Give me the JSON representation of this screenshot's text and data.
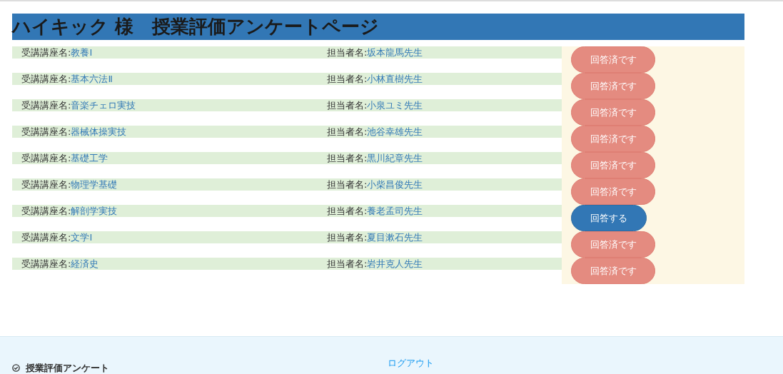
{
  "header": {
    "title": "ハイキック 様　授業評価アンケートページ"
  },
  "rows": [
    {
      "course_label": "受講講座名:",
      "course": "教養Ⅰ",
      "teacher_label": "担当者名:",
      "teacher": "坂本龍馬先生",
      "button": "回答済です",
      "answered": true
    },
    {
      "course_label": "受講講座名:",
      "course": "基本六法Ⅱ",
      "teacher_label": "担当者名:",
      "teacher": "小林直樹先生",
      "button": "回答済です",
      "answered": true
    },
    {
      "course_label": "受講講座名:",
      "course": "音楽チェロ実技",
      "teacher_label": "担当者名:",
      "teacher": "小泉ユミ先生",
      "button": "回答済です",
      "answered": true
    },
    {
      "course_label": "受講講座名:",
      "course": "器械体操実技",
      "teacher_label": "担当者名:",
      "teacher": "池谷幸雄先生",
      "button": "回答済です",
      "answered": true
    },
    {
      "course_label": "受講講座名:",
      "course": "基礎工学",
      "teacher_label": "担当者名:",
      "teacher": "黒川紀章先生",
      "button": "回答済です",
      "answered": true
    },
    {
      "course_label": "受講講座名:",
      "course": "物理学基礎",
      "teacher_label": "担当者名:",
      "teacher": "小柴昌俊先生",
      "button": "回答済です",
      "answered": true
    },
    {
      "course_label": "受講講座名:",
      "course": "解剖学実技",
      "teacher_label": "担当者名:",
      "teacher": "養老孟司先生",
      "button": "回答する",
      "answered": false
    },
    {
      "course_label": "受講講座名:",
      "course": "文学Ⅰ",
      "teacher_label": "担当者名:",
      "teacher": "夏目漱石先生",
      "button": "回答済です",
      "answered": true
    },
    {
      "course_label": "受講講座名:",
      "course": "経済史",
      "teacher_label": "担当者名:",
      "teacher": "岩井克人先生",
      "button": "回答済です",
      "answered": true
    }
  ],
  "footer": {
    "nav_item": "授業評価アンケート",
    "logout": "ログアウト"
  }
}
